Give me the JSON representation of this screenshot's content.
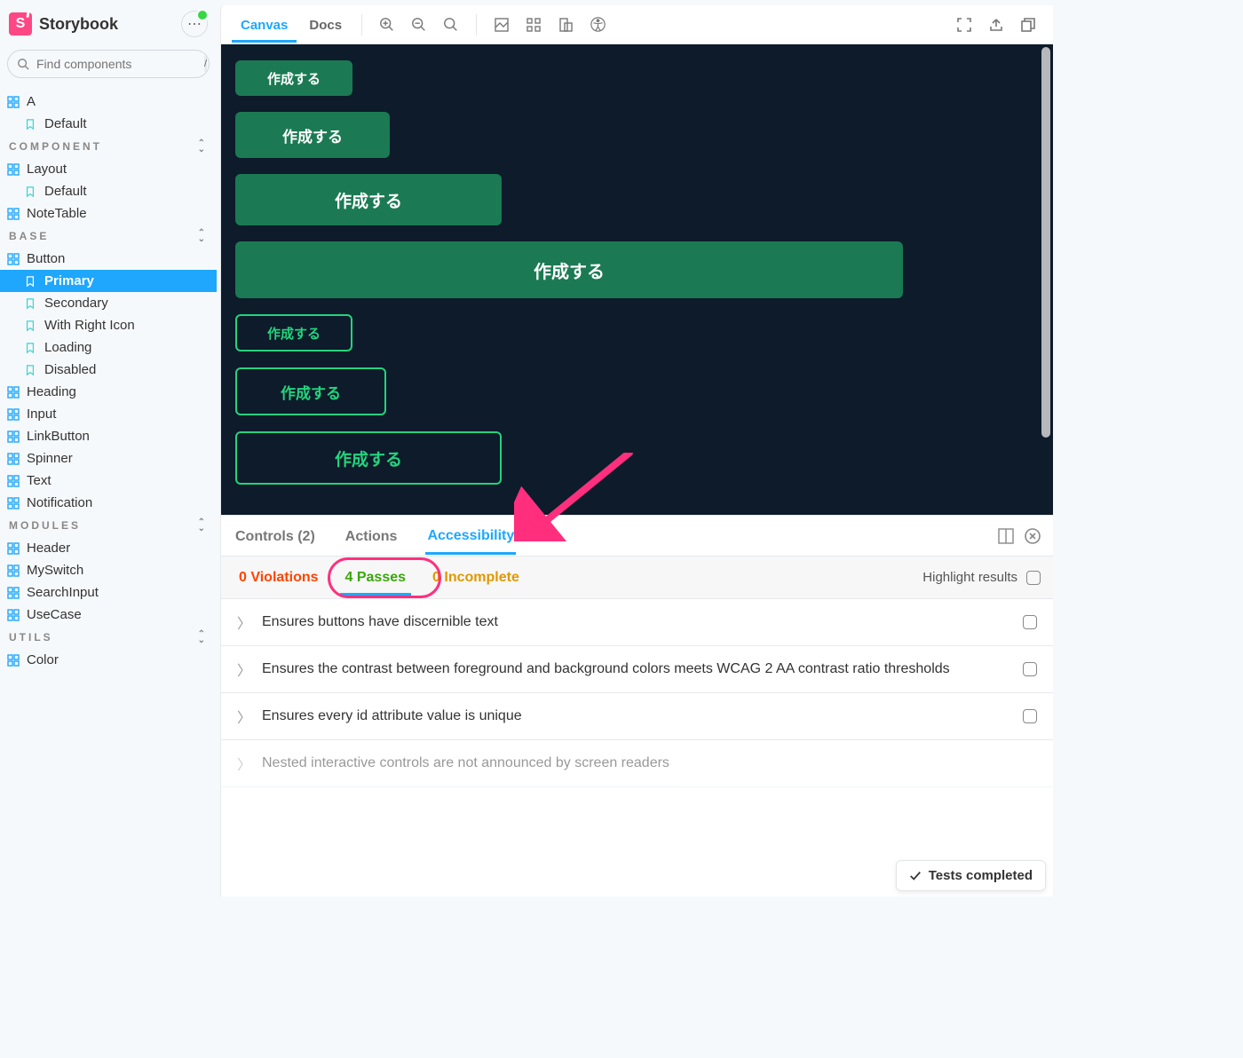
{
  "app": {
    "name": "Storybook",
    "logo_letter": "S"
  },
  "search": {
    "placeholder": "Find components",
    "shortcut": "/"
  },
  "sidebar": {
    "top": {
      "label": "A",
      "stories": [
        "Default"
      ]
    },
    "sections": [
      {
        "title": "COMPONENT",
        "items": [
          {
            "label": "Layout",
            "stories": [
              "Default"
            ]
          },
          {
            "label": "NoteTable"
          }
        ]
      },
      {
        "title": "BASE",
        "items": [
          {
            "label": "Button",
            "stories": [
              "Primary",
              "Secondary",
              "With Right Icon",
              "Loading",
              "Disabled"
            ],
            "active_story": "Primary"
          },
          {
            "label": "Heading"
          },
          {
            "label": "Input"
          },
          {
            "label": "LinkButton"
          },
          {
            "label": "Spinner"
          },
          {
            "label": "Text"
          },
          {
            "label": "Notification"
          }
        ]
      },
      {
        "title": "MODULES",
        "items": [
          {
            "label": "Header"
          },
          {
            "label": "MySwitch"
          },
          {
            "label": "SearchInput"
          },
          {
            "label": "UseCase"
          }
        ]
      },
      {
        "title": "UTILS",
        "items": [
          {
            "label": "Color"
          }
        ]
      }
    ]
  },
  "toolbar": {
    "tabs": [
      "Canvas",
      "Docs"
    ],
    "active": "Canvas"
  },
  "canvas": {
    "button_label": "作成する"
  },
  "addons": {
    "tabs": [
      {
        "label": "Controls (2)"
      },
      {
        "label": "Actions"
      },
      {
        "label": "Accessibility"
      }
    ],
    "active": "Accessibility",
    "a11y": {
      "violations": "0 Violations",
      "passes": "4 Passes",
      "incomplete": "0 Incomplete",
      "highlight_label": "Highlight results",
      "rules": [
        "Ensures buttons have discernible text",
        "Ensures the contrast between foreground and background colors meets WCAG 2 AA contrast ratio thresholds",
        "Ensures every id attribute value is unique",
        "Nested interactive controls are not announced by screen readers"
      ]
    }
  },
  "footer": {
    "tests_status": "Tests completed"
  }
}
